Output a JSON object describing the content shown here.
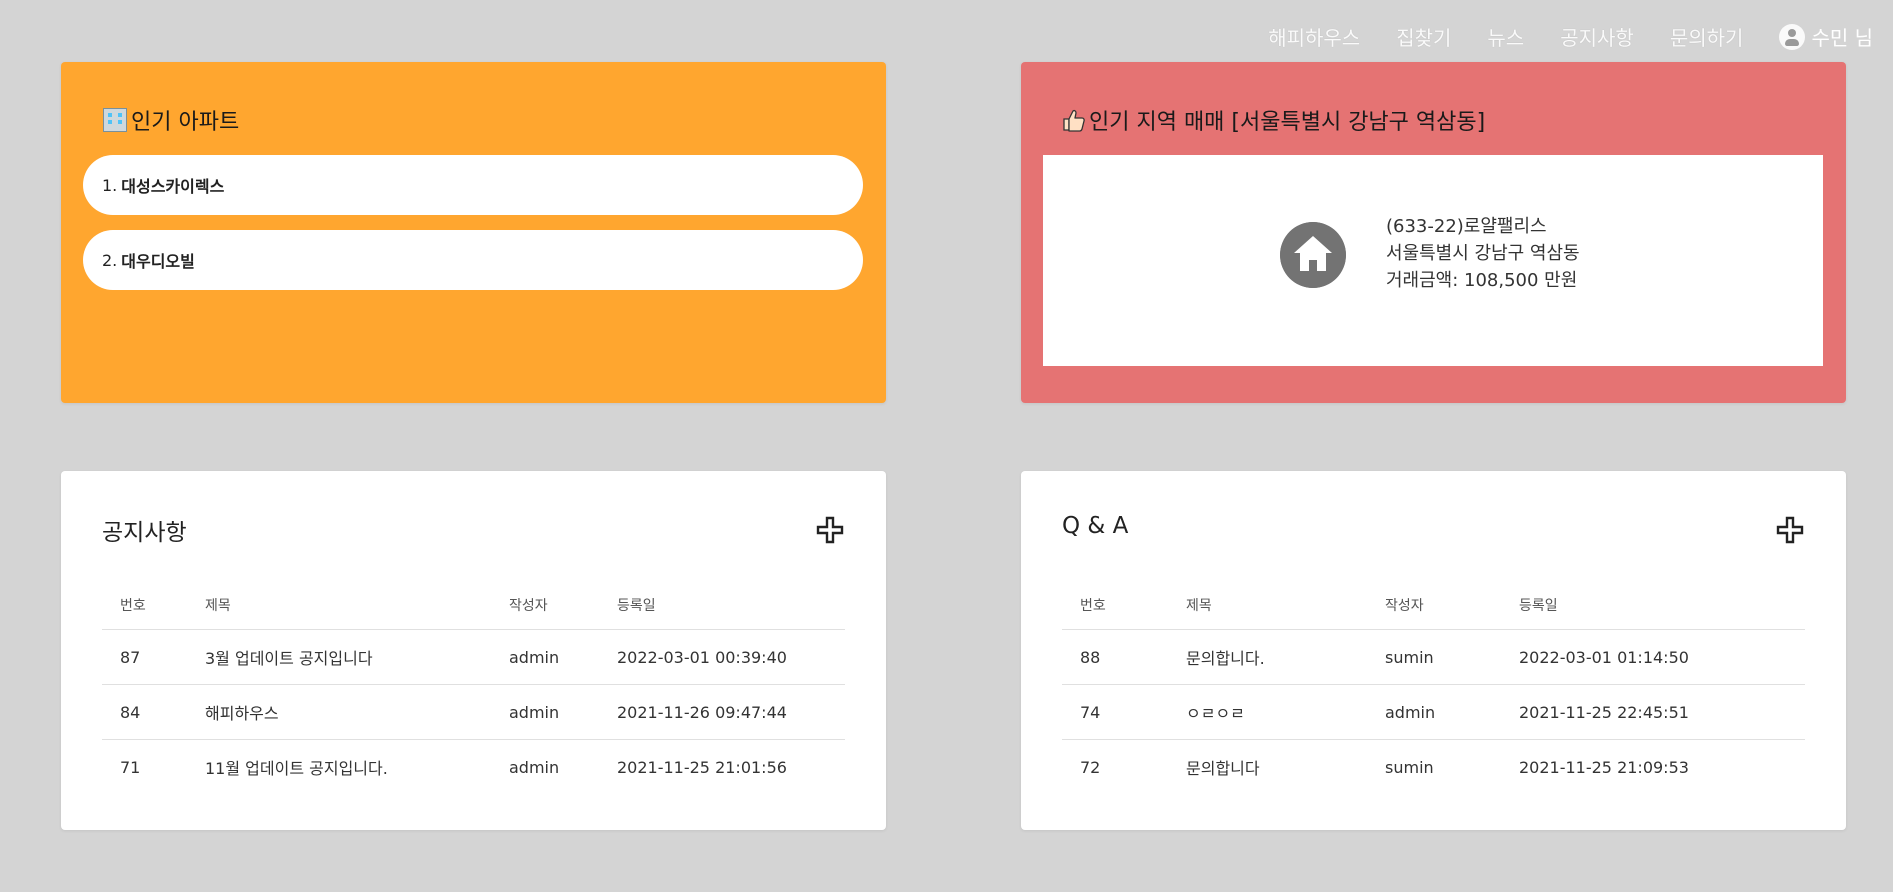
{
  "nav": {
    "items": [
      "해피하우스",
      "집찾기",
      "뉴스",
      "공지사항",
      "문의하기"
    ],
    "user_label": "수민 님"
  },
  "popular_apts": {
    "title": "인기 아파트",
    "items": [
      {
        "num": "1.",
        "name": "대성스카이렉스"
      },
      {
        "num": "2.",
        "name": "대우디오빌"
      }
    ]
  },
  "popular_deals": {
    "title": "인기 지역 매매 [서울특별시 강남구 역삼동]",
    "deal": {
      "name": "(633-22)로얄팰리스",
      "address": "서울특별시 강남구 역삼동",
      "price": "거래금액: 108,500 만원"
    }
  },
  "notice": {
    "title": "공지사항",
    "headers": [
      "번호",
      "제목",
      "작성자",
      "등록일"
    ],
    "rows": [
      [
        "87",
        "3월 업데이트 공지입니다",
        "admin",
        "2022-03-01 00:39:40"
      ],
      [
        "84",
        "해피하우스",
        "admin",
        "2021-11-26 09:47:44"
      ],
      [
        "71",
        "11월 업데이트 공지입니다.",
        "admin",
        "2021-11-25 21:01:56"
      ]
    ]
  },
  "qna": {
    "title": "Q & A",
    "headers": [
      "번호",
      "제목",
      "작성자",
      "등록일"
    ],
    "rows": [
      [
        "88",
        "문의합니다.",
        "sumin",
        "2022-03-01 01:14:50"
      ],
      [
        "74",
        "ㅇㄹㅇㄹ",
        "admin",
        "2021-11-25 22:45:51"
      ],
      [
        "72",
        "문의합니다",
        "sumin",
        "2021-11-25 21:09:53"
      ]
    ]
  },
  "colors": {
    "background": "#d4d4d4",
    "orange_card": "#ffa62f",
    "red_card": "#e57373"
  },
  "icons": [
    "user-account-icon",
    "building-icon",
    "thumbs-up-icon",
    "home-icon",
    "plus-icon"
  ]
}
